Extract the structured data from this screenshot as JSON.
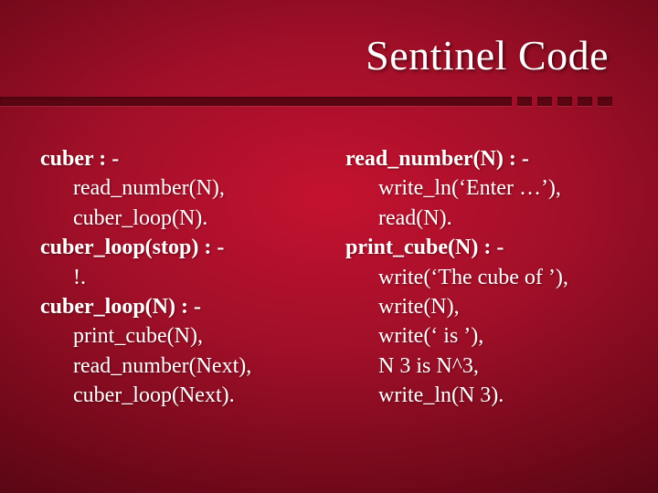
{
  "title": "Sentinel Code",
  "left": {
    "c1_head": "cuber : -",
    "c1_l1": "read_number(N),",
    "c1_l2": "cuber_loop(N).",
    "c2_head": "cuber_loop(stop) : -",
    "c2_l1": "!.",
    "c3_head": "cuber_loop(N) : -",
    "c3_l1": "print_cube(N),",
    "c3_l2": "read_number(Next),",
    "c3_l3": "cuber_loop(Next)."
  },
  "right": {
    "c1_head": "read_number(N) : -",
    "c1_l1": "write_ln(‘Enter …’),",
    "c1_l2": "read(N).",
    "c2_head": "print_cube(N) : -",
    "c2_l1": "write(‘The cube of ’),",
    "c2_l2": "write(N),",
    "c2_l3": "write(‘ is ’),",
    "c2_l4": "N 3 is N^3,",
    "c2_l5": "write_ln(N 3)."
  }
}
